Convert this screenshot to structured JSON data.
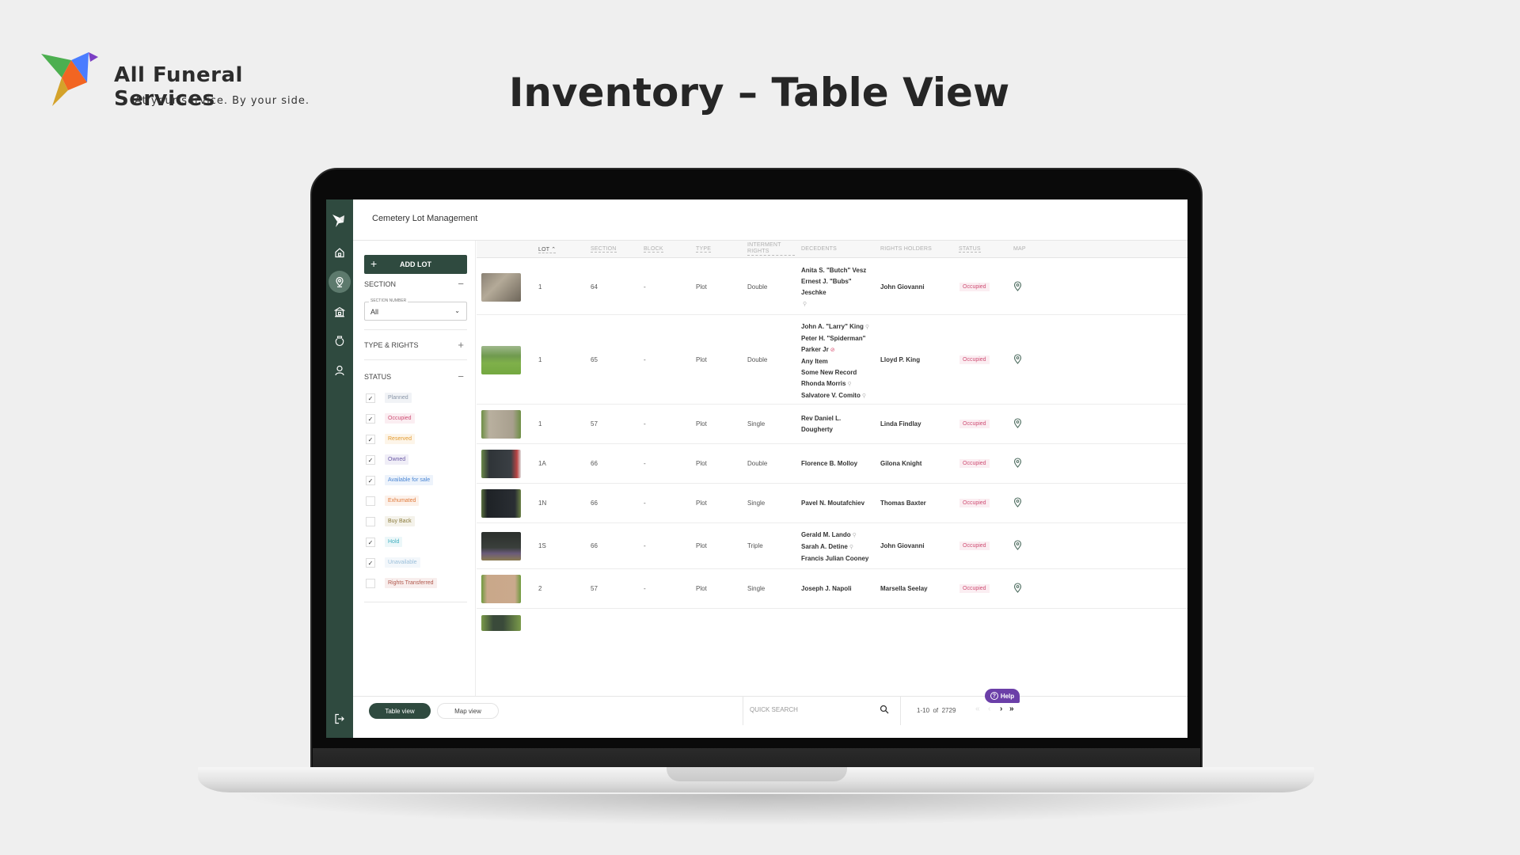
{
  "brand": {
    "name": "All Funeral Services",
    "tagline": "At your service. By your side.",
    "colors": {
      "green": "#4caf50",
      "orange": "#f26522",
      "blue": "#4a7dff",
      "purple": "#7b3fc4",
      "gold": "#d4a22a"
    }
  },
  "page_title": "Inventory – Table View",
  "app": {
    "title": "Cemetery Lot Management",
    "accent": "#2f4a3f",
    "rail": [
      {
        "icon": "logo-icon",
        "active": false
      },
      {
        "icon": "home-icon",
        "active": false
      },
      {
        "icon": "location-pin-icon",
        "active": true
      },
      {
        "icon": "building-icon",
        "active": false
      },
      {
        "icon": "urn-icon",
        "active": false
      },
      {
        "icon": "user-icon",
        "active": false
      },
      {
        "icon": "logout-icon",
        "active": false
      }
    ]
  },
  "filters": {
    "add_lot_label": "ADD LOT",
    "section": {
      "label": "SECTION",
      "toggle": "−",
      "select_legend": "SECTION NUMBER",
      "select_value": "All"
    },
    "type_rights": {
      "label": "TYPE & RIGHTS",
      "toggle": "+"
    },
    "status": {
      "label": "STATUS",
      "toggle": "−",
      "items": [
        {
          "label": "Planned",
          "checked": true,
          "color": "#8a96a8",
          "bg": "#f1f3f6"
        },
        {
          "label": "Occupied",
          "checked": true,
          "color": "#cf4e74",
          "bg": "#fbeef2"
        },
        {
          "label": "Reserved",
          "checked": true,
          "color": "#e39a2f",
          "bg": "#fdf5e9"
        },
        {
          "label": "Owned",
          "checked": true,
          "color": "#6b5aa6",
          "bg": "#f0eef7"
        },
        {
          "label": "Available for sale",
          "checked": true,
          "color": "#4a86d4",
          "bg": "#edf3fb"
        },
        {
          "label": "Exhumated",
          "checked": false,
          "color": "#e07a3a",
          "bg": "#fcf1ea"
        },
        {
          "label": "Buy Back",
          "checked": false,
          "color": "#8a7a3a",
          "bg": "#f4f2ea"
        },
        {
          "label": "Hold",
          "checked": true,
          "color": "#3fb0c0",
          "bg": "#ecf7f9"
        },
        {
          "label": "Unavailable",
          "checked": true,
          "color": "#9cc0da",
          "bg": "#f3f7fb"
        },
        {
          "label": "Rights Transferred",
          "checked": false,
          "color": "#b0564a",
          "bg": "#f8eeed"
        }
      ]
    }
  },
  "table": {
    "columns": [
      "LOT",
      "SECTION",
      "BLOCK",
      "TYPE",
      "INTERMENT RIGHTS",
      "DECEDENTS",
      "RIGHTS HOLDERS",
      "STATUS",
      "MAP"
    ],
    "sort_indicator": "^",
    "rows": [
      {
        "lot": "1",
        "section": "64",
        "block": "-",
        "type": "Plot",
        "rights": "Double",
        "decedents": [
          {
            "name": "Anita S. \"Butch\" Vesz"
          },
          {
            "name": "Ernest J. \"Bubs\""
          },
          {
            "name": "Jeschke"
          },
          {
            "name": "",
            "icon": "search-person-icon"
          }
        ],
        "holder": "John Giovanni",
        "status": "Occupied",
        "thumb": "granite-heart"
      },
      {
        "lot": "1",
        "section": "65",
        "block": "-",
        "type": "Plot",
        "rights": "Double",
        "decedents": [
          {
            "name": "John A. \"Larry\" King",
            "icon": "person-icon"
          },
          {
            "name": "Peter H. \"Spiderman\""
          },
          {
            "name": "Parker Jr",
            "icon": "hidden-eye-icon"
          },
          {
            "name": "Any Item"
          },
          {
            "name": "Some New Record"
          },
          {
            "name": "Rhonda Morris",
            "icon": "search-person-icon"
          },
          {
            "name": "Salvatore V. Comito",
            "icon": "person-icon"
          }
        ],
        "holder": "Lloyd P. King",
        "status": "Occupied",
        "thumb": "grass-field"
      },
      {
        "lot": "1",
        "section": "57",
        "block": "-",
        "type": "Plot",
        "rights": "Single",
        "decedents": [
          {
            "name": "Rev Daniel L."
          },
          {
            "name": "Dougherty"
          }
        ],
        "holder": "Linda Findlay",
        "status": "Occupied",
        "thumb": "stone-grass"
      },
      {
        "lot": "1A",
        "section": "66",
        "block": "-",
        "type": "Plot",
        "rights": "Double",
        "decedents": [
          {
            "name": "Florence B. Molloy"
          }
        ],
        "holder": "Gilona Knight",
        "status": "Occupied",
        "thumb": "dark-granite-flag"
      },
      {
        "lot": "1N",
        "section": "66",
        "block": "-",
        "type": "Plot",
        "rights": "Single",
        "decedents": [
          {
            "name": "Pavel N. Moutafchiev"
          }
        ],
        "holder": "Thomas Baxter",
        "status": "Occupied",
        "thumb": "black-granite"
      },
      {
        "lot": "1S",
        "section": "66",
        "block": "-",
        "type": "Plot",
        "rights": "Triple",
        "decedents": [
          {
            "name": "Gerald M. Lando",
            "icon": "person-icon"
          },
          {
            "name": "Sarah A. Detine",
            "icon": "person-icon"
          },
          {
            "name": "Francis Julian Cooney"
          }
        ],
        "holder": "John Giovanni",
        "status": "Occupied",
        "thumb": "black-granite-flowers"
      },
      {
        "lot": "2",
        "section": "57",
        "block": "-",
        "type": "Plot",
        "rights": "Single",
        "decedents": [
          {
            "name": "Joseph J. Napoli"
          }
        ],
        "holder": "Marsella Seelay",
        "status": "Occupied",
        "thumb": "tan-stone-grass"
      }
    ]
  },
  "bottom": {
    "table_view": "Table view",
    "map_view": "Map view",
    "search_placeholder": "QUICK SEARCH",
    "pager_range": "1-10",
    "pager_of": "of",
    "pager_total": "2729",
    "first": "«",
    "prev": "‹",
    "next": "›",
    "last": "»",
    "help": "Help"
  }
}
